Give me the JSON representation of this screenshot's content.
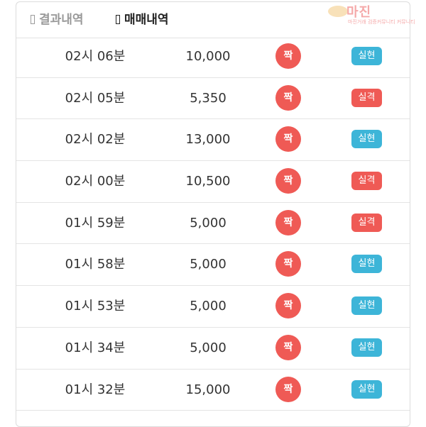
{
  "tabs": [
    {
      "label": "결과내역"
    },
    {
      "label": "매매내역"
    }
  ],
  "watermark": {
    "brand": "마진",
    "tagline": "마진거래 검증커뮤니티 커뮤니티"
  },
  "colors": {
    "pick_red": "#ef5a55",
    "result_win": "#3db5d8",
    "result_loss": "#ef5a55"
  },
  "trades": [
    {
      "time": "02시 06분",
      "amount": "10,000",
      "pick": "짝",
      "result": "실현",
      "result_type": "win"
    },
    {
      "time": "02시 05분",
      "amount": "5,350",
      "pick": "짝",
      "result": "실격",
      "result_type": "loss"
    },
    {
      "time": "02시 02분",
      "amount": "13,000",
      "pick": "짝",
      "result": "실현",
      "result_type": "win"
    },
    {
      "time": "02시 00분",
      "amount": "10,500",
      "pick": "짝",
      "result": "실격",
      "result_type": "loss"
    },
    {
      "time": "01시 59분",
      "amount": "5,000",
      "pick": "짝",
      "result": "실격",
      "result_type": "loss"
    },
    {
      "time": "01시 58분",
      "amount": "5,000",
      "pick": "짝",
      "result": "실현",
      "result_type": "win"
    },
    {
      "time": "01시 53분",
      "amount": "5,000",
      "pick": "짝",
      "result": "실현",
      "result_type": "win"
    },
    {
      "time": "01시 34분",
      "amount": "5,000",
      "pick": "짝",
      "result": "실현",
      "result_type": "win"
    },
    {
      "time": "01시 32분",
      "amount": "15,000",
      "pick": "짝",
      "result": "실현",
      "result_type": "win"
    }
  ]
}
